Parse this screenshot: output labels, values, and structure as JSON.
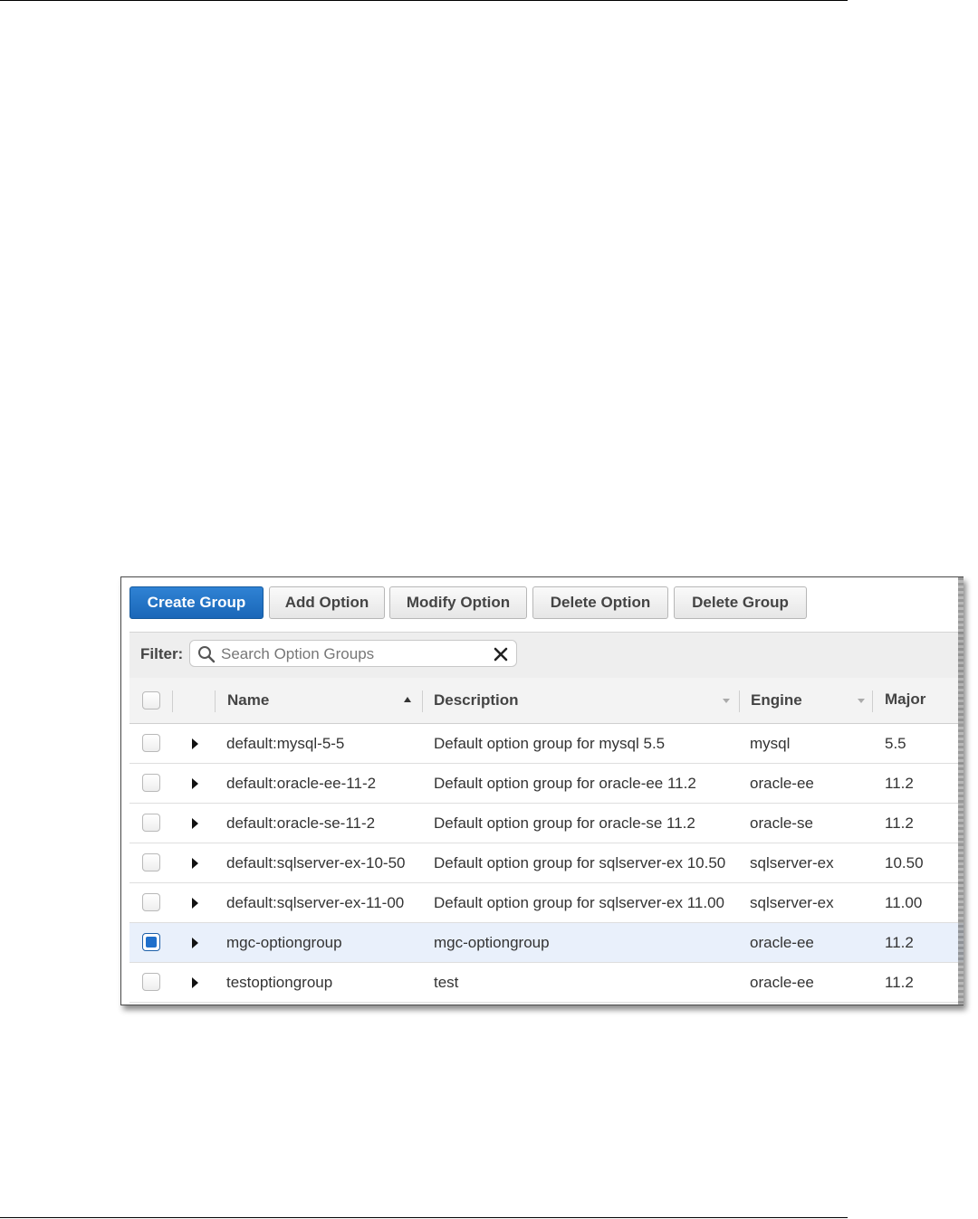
{
  "toolbar": {
    "buttons": [
      "Create Group",
      "Add Option",
      "Modify Option",
      "Delete Option",
      "Delete Group"
    ]
  },
  "filter": {
    "label": "Filter:",
    "placeholder": "Search Option Groups",
    "value": ""
  },
  "table": {
    "columns": [
      "Name",
      "Description",
      "Engine",
      "Major"
    ],
    "sorted_column": "Name",
    "sort_direction": "ascending",
    "rows": [
      {
        "name": "default:mysql-5-5",
        "description": "Default option group for mysql 5.5",
        "engine": "mysql",
        "major": "5.5",
        "selected": false
      },
      {
        "name": "default:oracle-ee-11-2",
        "description": "Default option group for oracle-ee 11.2",
        "engine": "oracle-ee",
        "major": "11.2",
        "selected": false
      },
      {
        "name": "default:oracle-se-11-2",
        "description": "Default option group for oracle-se 11.2",
        "engine": "oracle-se",
        "major": "11.2",
        "selected": false
      },
      {
        "name": "default:sqlserver-ex-10-50",
        "description": "Default option group for sqlserver-ex 10.50",
        "engine": "sqlserver-ex",
        "major": "10.50",
        "selected": false
      },
      {
        "name": "default:sqlserver-ex-11-00",
        "description": "Default option group for sqlserver-ex 11.00",
        "engine": "sqlserver-ex",
        "major": "11.00",
        "selected": false
      },
      {
        "name": "mgc-optiongroup",
        "description": "mgc-optiongroup",
        "engine": "oracle-ee",
        "major": "11.2",
        "selected": true
      },
      {
        "name": "testoptiongroup",
        "description": "test",
        "engine": "oracle-ee",
        "major": "11.2",
        "selected": false
      }
    ]
  },
  "colors": {
    "primary_button": "#1f6fcb",
    "selected_row": "#e9f0fb",
    "header_background": "#f3f3f3"
  }
}
